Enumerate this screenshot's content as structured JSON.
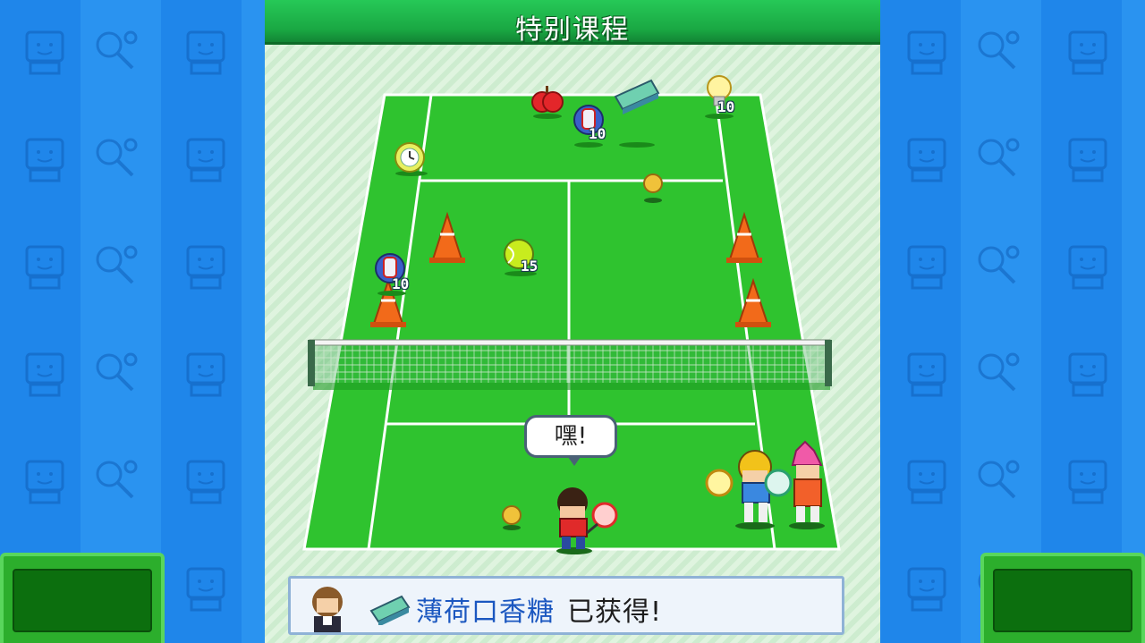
{
  "screen": {
    "title": "特别课程",
    "speech": "嘿!",
    "message": {
      "item_name": "薄荷口香糖",
      "suffix": "已获得!"
    }
  },
  "court_items": [
    {
      "name": "apple",
      "badge": ""
    },
    {
      "name": "blue-drink-bottle",
      "badge": "10"
    },
    {
      "name": "mint-gum-pack",
      "badge": ""
    },
    {
      "name": "lightbulb",
      "badge": "10"
    },
    {
      "name": "clock",
      "badge": ""
    },
    {
      "name": "tennis-ball",
      "badge": ""
    },
    {
      "name": "blue-drink-bottle",
      "badge": "10"
    },
    {
      "name": "tennis-ball-green",
      "badge": "15"
    }
  ],
  "colors": {
    "court": "#2fc32f",
    "court_line": "#ffffff",
    "title_bar": "#1fb44c",
    "side_bg": "#1f86ea",
    "message_text": "#1b57c0"
  }
}
